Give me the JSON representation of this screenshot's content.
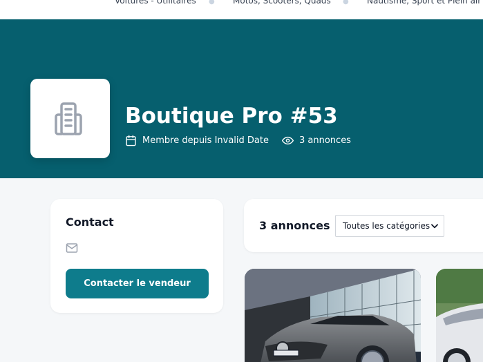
{
  "topnav": {
    "items": [
      {
        "label": "Voitures - Utilitaires"
      },
      {
        "label": "Motos, Scooters, Quads"
      },
      {
        "label": "Nautisme, Sport et Plein air"
      }
    ]
  },
  "shop": {
    "name": "Boutique Pro #53",
    "member_since": "Membre depuis Invalid Date",
    "listings_count": "3 annonces",
    "logo_icon": "building-icon"
  },
  "contact": {
    "title": "Contact",
    "email_icon": "mail-icon",
    "button_label": "Contacter le vendeur"
  },
  "listings": {
    "header_count": "3 annonces",
    "category_filter": {
      "selected": "Toutes les catégories"
    }
  },
  "colors": {
    "hero_bg": "#065f6e",
    "accent_button": "#0e7c8c",
    "page_bg": "#f5f7f9"
  }
}
